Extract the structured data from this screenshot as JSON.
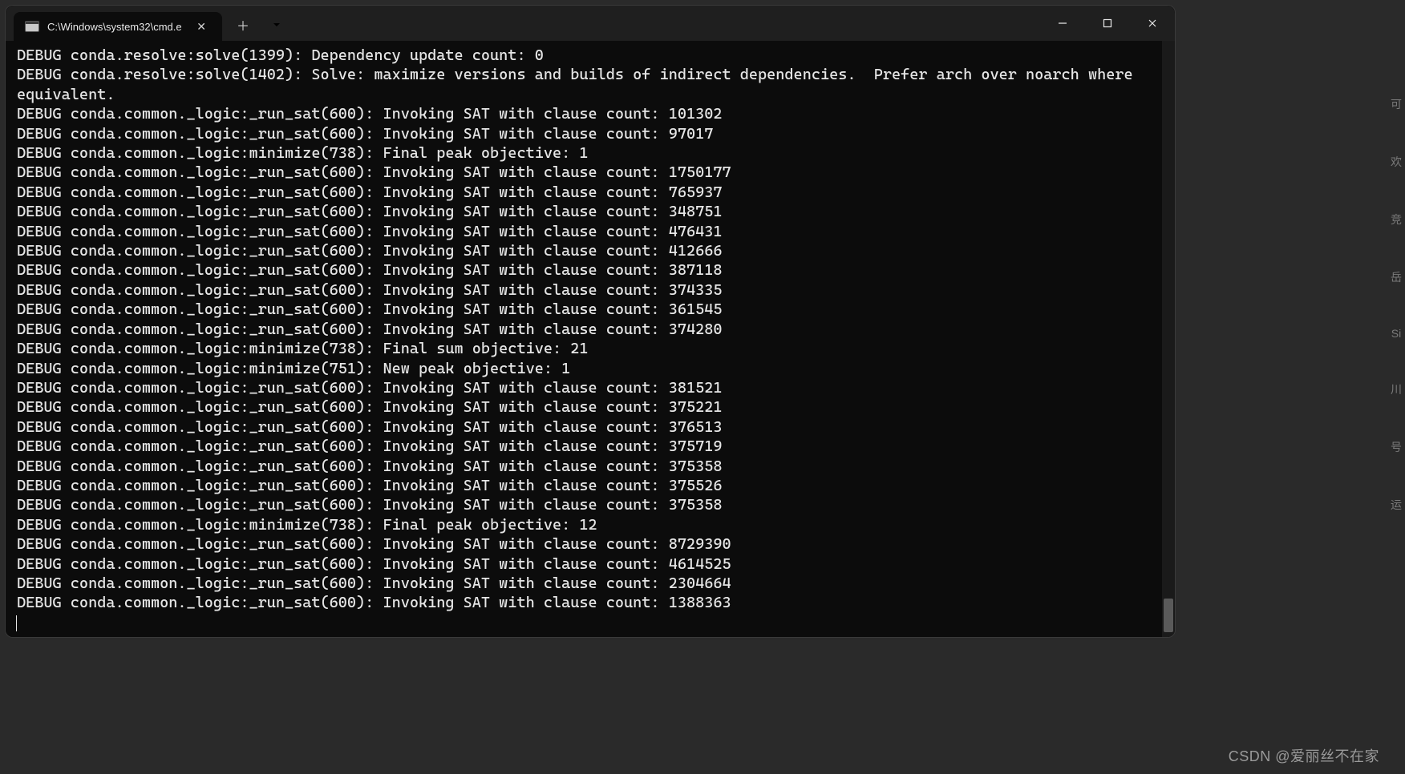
{
  "tab": {
    "title": "C:\\Windows\\system32\\cmd.e"
  },
  "terminal": {
    "lines": [
      "DEBUG conda.resolve:solve(1399): Dependency update count: 0",
      "DEBUG conda.resolve:solve(1402): Solve: maximize versions and builds of indirect dependencies.  Prefer arch over noarch where equivalent.",
      "DEBUG conda.common._logic:_run_sat(600): Invoking SAT with clause count: 101302",
      "DEBUG conda.common._logic:_run_sat(600): Invoking SAT with clause count: 97017",
      "DEBUG conda.common._logic:minimize(738): Final peak objective: 1",
      "DEBUG conda.common._logic:_run_sat(600): Invoking SAT with clause count: 1750177",
      "DEBUG conda.common._logic:_run_sat(600): Invoking SAT with clause count: 765937",
      "DEBUG conda.common._logic:_run_sat(600): Invoking SAT with clause count: 348751",
      "DEBUG conda.common._logic:_run_sat(600): Invoking SAT with clause count: 476431",
      "DEBUG conda.common._logic:_run_sat(600): Invoking SAT with clause count: 412666",
      "DEBUG conda.common._logic:_run_sat(600): Invoking SAT with clause count: 387118",
      "DEBUG conda.common._logic:_run_sat(600): Invoking SAT with clause count: 374335",
      "DEBUG conda.common._logic:_run_sat(600): Invoking SAT with clause count: 361545",
      "DEBUG conda.common._logic:_run_sat(600): Invoking SAT with clause count: 374280",
      "DEBUG conda.common._logic:minimize(738): Final sum objective: 21",
      "DEBUG conda.common._logic:minimize(751): New peak objective: 1",
      "DEBUG conda.common._logic:_run_sat(600): Invoking SAT with clause count: 381521",
      "DEBUG conda.common._logic:_run_sat(600): Invoking SAT with clause count: 375221",
      "DEBUG conda.common._logic:_run_sat(600): Invoking SAT with clause count: 376513",
      "DEBUG conda.common._logic:_run_sat(600): Invoking SAT with clause count: 375719",
      "DEBUG conda.common._logic:_run_sat(600): Invoking SAT with clause count: 375358",
      "DEBUG conda.common._logic:_run_sat(600): Invoking SAT with clause count: 375526",
      "DEBUG conda.common._logic:_run_sat(600): Invoking SAT with clause count: 375358",
      "DEBUG conda.common._logic:minimize(738): Final peak objective: 12",
      "DEBUG conda.common._logic:_run_sat(600): Invoking SAT with clause count: 8729390",
      "DEBUG conda.common._logic:_run_sat(600): Invoking SAT with clause count: 4614525",
      "DEBUG conda.common._logic:_run_sat(600): Invoking SAT with clause count: 2304664",
      "DEBUG conda.common._logic:_run_sat(600): Invoking SAT with clause count: 1388363"
    ]
  },
  "watermark": "CSDN @爱丽丝不在家",
  "side_hints": [
    "可",
    "欢",
    "竞",
    "岳",
    "Si",
    "川",
    "号",
    "运"
  ]
}
